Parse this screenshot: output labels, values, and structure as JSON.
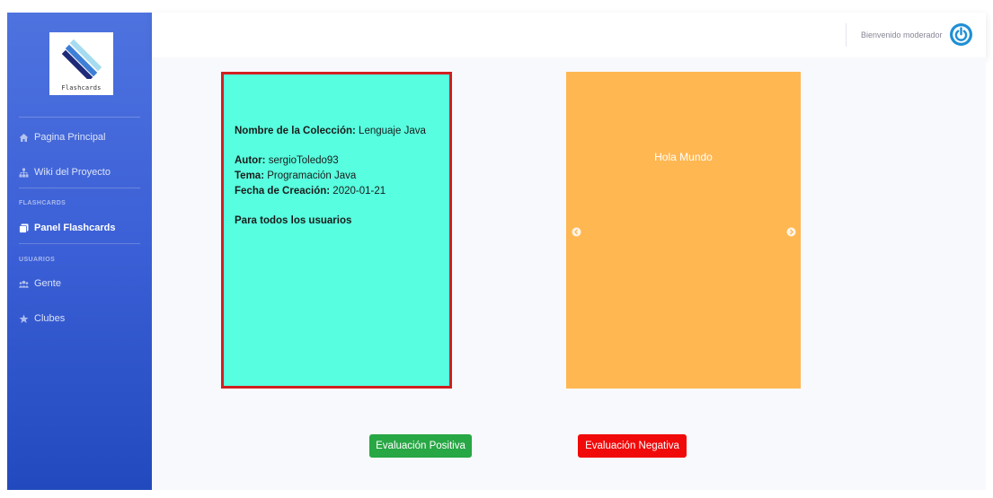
{
  "app": {
    "logo_text": "Flashcards"
  },
  "sidebar": {
    "items": [
      {
        "label": "Pagina Principal",
        "icon": "home-icon"
      },
      {
        "label": "Wiki del Proyecto",
        "icon": "sitemap-icon"
      }
    ],
    "sections": [
      {
        "heading": "FLASHCARDS",
        "items": [
          {
            "label": "Panel Flashcards",
            "icon": "copy-icon",
            "active": true
          }
        ]
      },
      {
        "heading": "USUARIOS",
        "items": [
          {
            "label": "Gente",
            "icon": "users-icon"
          },
          {
            "label": "Clubes",
            "icon": "star-icon"
          }
        ]
      }
    ]
  },
  "topbar": {
    "welcome": "Bienvenido moderador",
    "power_icon": "power-icon"
  },
  "collection": {
    "name_label": "Nombre de la Colección:",
    "name_value": "Lenguaje Java",
    "author_label": "Autor:",
    "author_value": "sergioToledo93",
    "topic_label": "Tema:",
    "topic_value": "Programación Java",
    "date_label": "Fecha de Creación:",
    "date_value": "2020-01-21",
    "audience": "Para todos los usuarios"
  },
  "flashcard": {
    "text": "Hola Mundo"
  },
  "actions": {
    "positive": "Evaluación Positiva",
    "negative": "Evaluación Negativa"
  },
  "colors": {
    "sidebar_top": "#4e73df",
    "sidebar_bottom": "#224abe",
    "info_card": "#57ffe0",
    "info_border": "#d01f1f",
    "flashcard": "#ffb752",
    "positive": "#28a745",
    "negative": "#f10a0a"
  }
}
